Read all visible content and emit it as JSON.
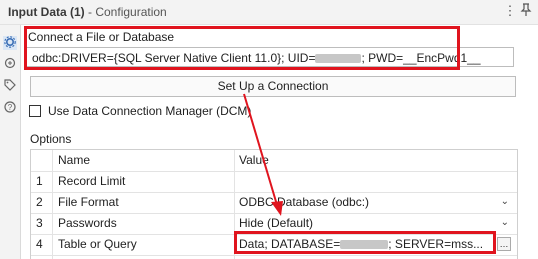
{
  "window": {
    "title": "Input Data (1)",
    "subtitle": "- Configuration",
    "menu_icon": "more-vertical-icon",
    "pin_icon": "pin-icon"
  },
  "left_toolbar": {
    "icons": [
      "gear-icon",
      "refresh-arrows-icon",
      "tag-icon",
      "help-icon"
    ]
  },
  "connect": {
    "heading": "Connect a File or Database",
    "value_prefix": "odbc:DRIVER={SQL Server Native Client 11.0}; UID=",
    "value_suffix": "; PWD=__EncPwd1__"
  },
  "setup_button": {
    "label": "Set Up a Connection"
  },
  "dcm": {
    "label": "Use Data Connection Manager (DCM)",
    "checked": false
  },
  "options": {
    "label": "Options",
    "columns": [
      "Name",
      "Value"
    ],
    "rows": [
      {
        "num": "1",
        "name": "Record Limit",
        "value": ""
      },
      {
        "num": "2",
        "name": "File Format",
        "value": "ODBC Database (odbc:)"
      },
      {
        "num": "3",
        "name": "Passwords",
        "value": "Hide (Default)"
      },
      {
        "num": "4",
        "name": "Table or Query",
        "value_prefix": "Data;  DATABASE=",
        "value_suffix": ";  SERVER=mss..."
      }
    ]
  },
  "colors": {
    "highlight": "#e0141e",
    "panel_bg": "#f3f3f3"
  }
}
